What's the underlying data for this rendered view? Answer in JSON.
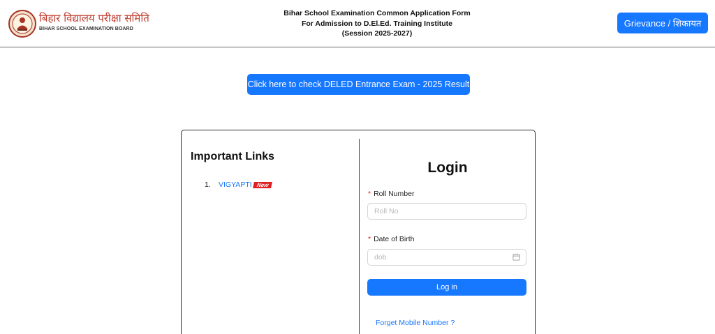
{
  "header": {
    "brand_hindi": "बिहार विद्यालय परीक्षा समिति",
    "brand_english": "BIHAR SCHOOL EXAMINATION BOARD",
    "title_line1": "Bihar School Examination Common Application Form",
    "title_line2": "For Admission to D.El.Ed. Training Institute",
    "title_line3": "(Session 2025-2027)",
    "grievance_label": "Grievance / शिकायत"
  },
  "result_button_label": "Click here to check DELED Entrance Exam - 2025 Result",
  "important_links": {
    "title": "Important Links",
    "items": [
      {
        "number": "1.",
        "label": "VIGYAPTI",
        "badge": "New"
      }
    ]
  },
  "login": {
    "title": "Login",
    "required_mark": "*",
    "roll_label": "Roll Number",
    "roll_placeholder": "Roll No",
    "dob_label": "Date of Birth",
    "dob_placeholder": "dob",
    "submit_label": "Log in",
    "forget_link": "Forget Mobile Number ?"
  },
  "icons": {
    "logo": "bseb-emblem-icon",
    "date_picker": "calendar-icon"
  },
  "colors": {
    "primary": "#1677ff",
    "brand_red": "#c0392b",
    "badge_red": "#e02020"
  }
}
